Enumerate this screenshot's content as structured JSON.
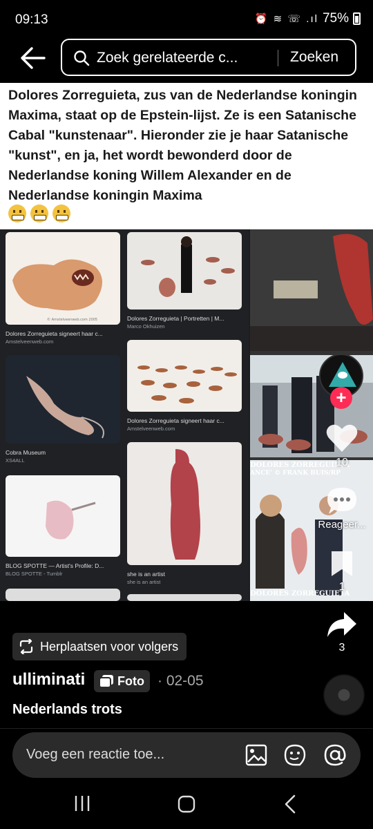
{
  "status": {
    "time": "09:13",
    "battery": "75%",
    "icons": "⏰ ≋ ☏ .ıl"
  },
  "search": {
    "placeholder": "Zoek gerelateerde c...",
    "button": "Zoeken"
  },
  "post": {
    "caption": "Dolores Zorreguieta, zus van de Nederlandse koningin Maxima, staat op de Epstein-lijst. Ze is een Satanische Cabal \"kunstenaar\". Hieronder zie je haar Satanische \"kunst\", en ja, het wordt bewonderd door de Nederlandse koning Willem Alexander en de Nederlandse koningin Maxima",
    "results": [
      {
        "caption": "Dolores Zorreguieta signeert haar c...",
        "source": "Amstelveenweb.com"
      },
      {
        "caption": "Dolores Zorreguieta | Portretten | M...",
        "source": "Marco Okhuizen"
      },
      {
        "caption": "Cobra Museum",
        "source": "XS4ALL"
      },
      {
        "caption": "Dolores Zorreguieta signeert haar c...",
        "source": "Amstelveenweb.com"
      },
      {
        "caption": "BLOG SPOTTE — Artist's Profile: D...",
        "source": "BLOG SPOTTE - Tumblr"
      },
      {
        "caption": "she is an artist",
        "source": "she is an artist"
      }
    ],
    "watermark": "DOLORES ZORREGUIETA",
    "photo_credit": "ANCE' © FRANK BUIS/RP"
  },
  "actions": {
    "likes": "10",
    "comment_label": "Reageer...",
    "saves": "1",
    "shares": "3"
  },
  "info": {
    "repost_label": "Herplaatsen voor volgers",
    "author": "ulliminati",
    "type_badge": "Foto",
    "date": "· 02-05",
    "title": "Nederlands trots"
  },
  "comment": {
    "placeholder": "Voeg een reactie toe..."
  },
  "colors": {
    "accent": "#fe2c55",
    "background": "#000000"
  }
}
